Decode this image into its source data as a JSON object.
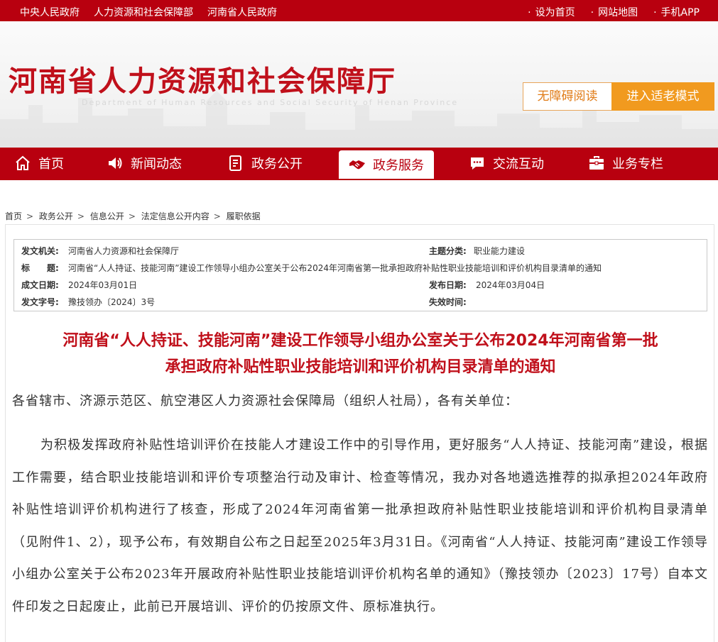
{
  "topbar": {
    "links_left": [
      "中央人民政府",
      "人力资源和社会保障部",
      "河南省人民政府"
    ],
    "links_right": [
      "设为首页",
      "网站地图",
      "手机APP"
    ]
  },
  "header": {
    "title": "河南省人力资源和社会保障厅",
    "subtitle": "Department of Human Resources and Social Security of Henan Province",
    "accessibility_label": "无障碍阅读",
    "elder_mode_label": "进入适老模式"
  },
  "nav": {
    "items": [
      {
        "label": "首页",
        "icon": "home-icon"
      },
      {
        "label": "新闻动态",
        "icon": "speaker-icon"
      },
      {
        "label": "政务公开",
        "icon": "document-icon"
      },
      {
        "label": "政务服务",
        "icon": "handshake-icon",
        "active": true
      },
      {
        "label": "交流互动",
        "icon": "chat-icon"
      },
      {
        "label": "业务专栏",
        "icon": "briefcase-icon"
      }
    ]
  },
  "breadcrumb": [
    "首页",
    "政务公开",
    "信息公开",
    "法定信息公开内容",
    "履职依据"
  ],
  "meta": {
    "issuer_label": "发文机关:",
    "issuer": "河南省人力资源和社会保障厅",
    "topic_label": "主题分类:",
    "topic": "职业能力建设",
    "title_label": "标　　题:",
    "title": "河南省“人人持证、技能河南”建设工作领导小组办公室关于公布2024年河南省第一批承担政府补贴性职业技能培训和评价机构目录清单的通知",
    "created_label": "成文日期:",
    "created": "2024年03月01日",
    "published_label": "发布日期:",
    "published": "2024年03月04日",
    "doc_no_label": "发文字号:",
    "doc_no": "豫技领办〔2024〕3号",
    "expiry_label": "失效时间:",
    "expiry": ""
  },
  "document": {
    "title_line1": "河南省“人人持证、技能河南”建设工作领导小组办公室关于公布2024年河南省第一批",
    "title_line2": "承担政府补贴性职业技能培训和评价机构目录清单的通知",
    "salutation": "各省辖市、济源示范区、航空港区人力资源社会保障局（组织人社局），各有关单位：",
    "paragraph": "为积极发挥政府补贴性培训评价在技能人才建设工作中的引导作用，更好服务“人人持证、技能河南”建设，根据工作需要，结合职业技能培训和评价专项整治行动及审计、检查等情况，我办对各地遴选推荐的拟承担2024年政府补贴性培训评价机构进行了核查，形成了2024年河南省第一批承担政府补贴性职业技能培训和评价机构目录清单（见附件1、2），现予公布，有效期自公布之日起至2025年3月31日。《河南省“人人持证、技能河南”建设工作领导小组办公室关于公布2023年开展政府补贴性职业技能培训评价机构名单的通知》（豫技领办〔2023〕17号）自本文件印发之日起废止，此前已开展培训、评价的仍按原文件、原标准执行。"
  },
  "colors": {
    "brand_red": "#b8000f",
    "title_red": "#c0101b",
    "accent_orange": "#f19a1f"
  }
}
